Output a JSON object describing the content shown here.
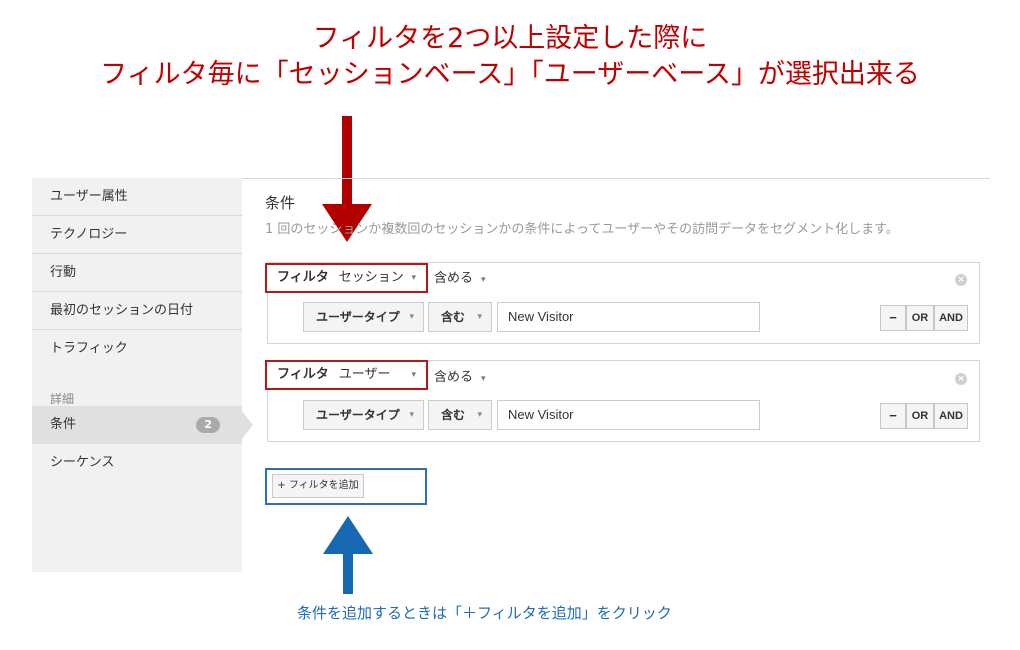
{
  "annotation": {
    "title_line1": "フィルタを2つ以上設定した際に",
    "title_line2": "フィルタ毎に「セッションベース」「ユーザーベース」が選択出来る",
    "bottom_note": "条件を追加するときは「＋フィルタを追加」をクリック",
    "colors": {
      "title": "#c00000",
      "note": "#1f6bb8",
      "highlight_red": "#b51818",
      "highlight_blue": "#2f6fb7"
    }
  },
  "sidebar": {
    "items": [
      "ユーザー属性",
      "テクノロジー",
      "行動",
      "最初のセッションの日付",
      "トラフィック"
    ],
    "section_label": "詳細",
    "active_item": {
      "label": "条件",
      "badge": "2"
    },
    "last_item": "シーケンス"
  },
  "main": {
    "title": "条件",
    "description": "1 回のセッションか複数回のセッションかの条件によってユーザーやその訪問データをセグメント化します。",
    "filters": [
      {
        "label": "フィルタ",
        "scope": "セッション",
        "include": "含める",
        "condition": {
          "dimension": "ユーザータイプ",
          "operator": "含む",
          "value": "New Visitor"
        },
        "buttons": {
          "minus": "−",
          "or": "OR",
          "and": "AND"
        }
      },
      {
        "label": "フィルタ",
        "scope": "ユーザー",
        "include": "含める",
        "condition": {
          "dimension": "ユーザータイプ",
          "operator": "含む",
          "value": "New Visitor"
        },
        "buttons": {
          "minus": "−",
          "or": "OR",
          "and": "AND"
        }
      }
    ],
    "add_filter_label": "+ フィルタを追加"
  },
  "icons": {
    "caret": "▾",
    "remove": "×"
  }
}
